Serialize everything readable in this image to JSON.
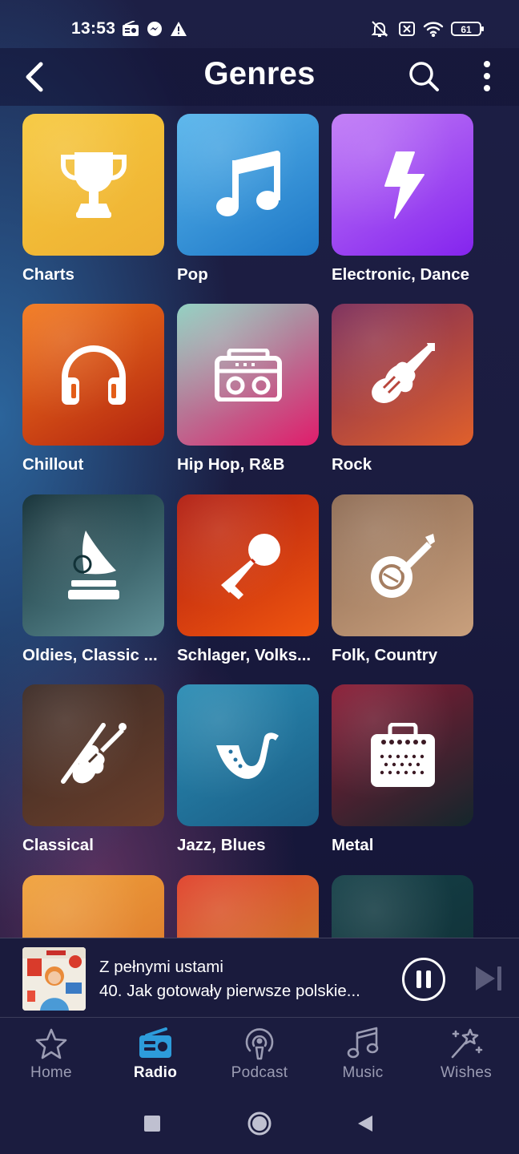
{
  "status_bar": {
    "time": "13:53",
    "battery": "61",
    "icons": [
      "radio-icon",
      "messenger-icon",
      "warning-icon",
      "bell-off-icon",
      "sim-off-icon",
      "wifi-icon",
      "battery-icon"
    ]
  },
  "header": {
    "title": "Genres",
    "back_icon": "chevron-left-icon",
    "search_icon": "search-icon",
    "more_icon": "more-vertical-icon"
  },
  "genres": [
    {
      "label": "Charts",
      "icon": "trophy-icon",
      "colors": [
        "#f6c83c",
        "#eeb033"
      ]
    },
    {
      "label": "Pop",
      "icon": "music-note-icon",
      "colors": [
        "#57b5ec",
        "#1e77c6"
      ]
    },
    {
      "label": "Electronic, Dance",
      "icon": "lightning-icon",
      "colors": [
        "#c07af6",
        "#8424ee"
      ]
    },
    {
      "label": "Chillout",
      "icon": "headphones-icon",
      "colors": [
        "#f2791d",
        "#b2220f"
      ]
    },
    {
      "label": "Hip Hop, R&B",
      "icon": "boombox-icon",
      "colors": [
        "#8ed0c0",
        "#e01c6b"
      ]
    },
    {
      "label": "Rock",
      "icon": "electric-guitar-icon",
      "colors": [
        "#7a2a57",
        "#e0602b"
      ]
    },
    {
      "label": "Oldies, Classic ...",
      "icon": "gramophone-icon",
      "colors": [
        "#0f2c33",
        "#5f8f96"
      ]
    },
    {
      "label": "Schlager, Volks...",
      "icon": "microphone-icon",
      "colors": [
        "#b01c10",
        "#f0560f"
      ]
    },
    {
      "label": "Folk, Country",
      "icon": "banjo-icon",
      "colors": [
        "#8d6a52",
        "#c9a07d"
      ]
    },
    {
      "label": "Classical",
      "icon": "violin-icon",
      "colors": [
        "#3b2a25",
        "#6b3f2b"
      ]
    },
    {
      "label": "Jazz, Blues",
      "icon": "saxophone-icon",
      "colors": [
        "#2a8cb4",
        "#1a5d85"
      ]
    },
    {
      "label": "Metal",
      "icon": "amplifier-icon",
      "colors": [
        "#8a1a34",
        "#14262c"
      ]
    },
    {
      "label": "",
      "icon": "partial-icon",
      "colors": [
        "#f0a23b",
        "#d9702a"
      ]
    },
    {
      "label": "",
      "icon": "palm-tree-icon",
      "colors": [
        "#e0402a",
        "#c98a2a"
      ]
    },
    {
      "label": "",
      "icon": "partial-icon",
      "colors": [
        "#154048",
        "#0f2e34"
      ]
    }
  ],
  "now_playing": {
    "title": "Z pełnymi ustami",
    "subtitle": "40. Jak gotowały pierwsze polskie..."
  },
  "tabs": [
    {
      "label": "Home",
      "icon": "star-icon",
      "active": false
    },
    {
      "label": "Radio",
      "icon": "radio-icon",
      "active": true
    },
    {
      "label": "Podcast",
      "icon": "podcast-icon",
      "active": false
    },
    {
      "label": "Music",
      "icon": "music-note-icon",
      "active": false
    },
    {
      "label": "Wishes",
      "icon": "magic-wand-icon",
      "active": false
    }
  ],
  "colors": {
    "background": "#1d1f45",
    "accent": "#2d9cdb",
    "inactive_tab": "#9b9cb3"
  }
}
